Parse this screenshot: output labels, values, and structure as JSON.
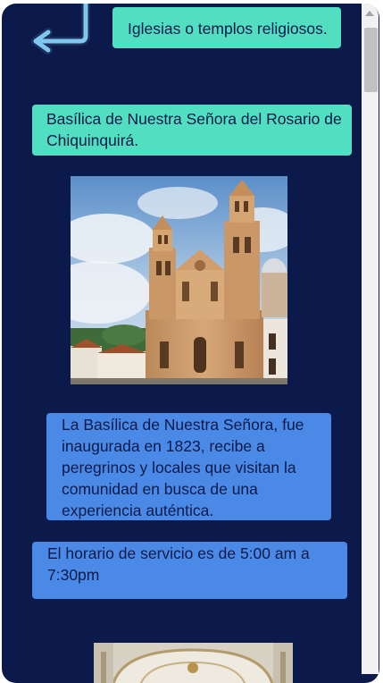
{
  "header": {
    "back_icon": "return-arrow-icon",
    "category": "Iglesias o templos religiosos."
  },
  "place": {
    "title": "Basílica de Nuestra Señora del Rosario de Chiquinquirá.",
    "photo_icon": "basilica-photo",
    "description": "La Basílica de Nuestra Señora, fue inaugurada en 1823, recibe a peregrinos y locales que visitan la comunidad en busca de una experiencia auténtica.",
    "hours": "El horario de servicio es de 5:00 am a 7:30pm",
    "photo2_icon": "basilica-interior-photo"
  },
  "colors": {
    "background": "#0b1a4a",
    "teal": "#52dfc1",
    "blue": "#4a8ae6",
    "arrow": "#7ec8ef"
  }
}
